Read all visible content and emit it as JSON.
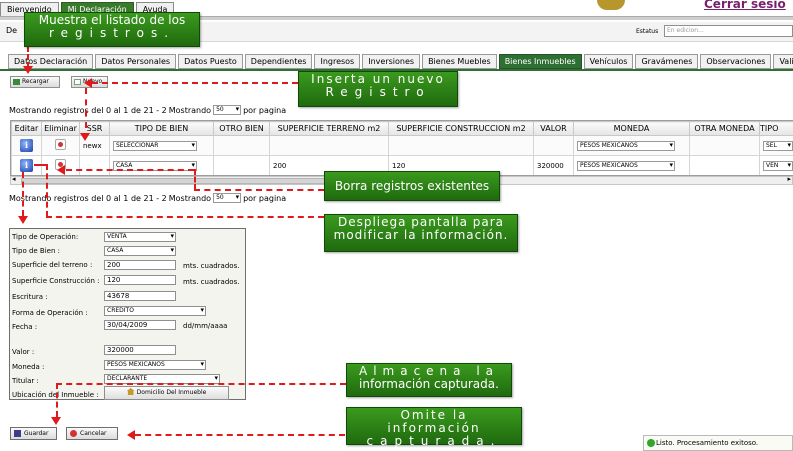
{
  "header": {
    "tabs": [
      {
        "label": "Bienvenido",
        "active": false
      },
      {
        "label": "Mi Declaración",
        "active": true
      },
      {
        "label": "Ayuda",
        "active": false
      }
    ],
    "logout_link": "Cerrar sesio"
  },
  "status_bar": {
    "prefix_label": "De",
    "estatus_label": "Estatus",
    "estatus_value": "En edicion..."
  },
  "section_tabs": [
    {
      "label": "Datos Declaración",
      "active": false
    },
    {
      "label": "Datos Personales",
      "active": false
    },
    {
      "label": "Datos Puesto",
      "active": false
    },
    {
      "label": "Dependientes",
      "active": false
    },
    {
      "label": "Ingresos",
      "active": false
    },
    {
      "label": "Inversiones",
      "active": false
    },
    {
      "label": "Bienes Muebles",
      "active": false
    },
    {
      "label": "Bienes Inmuebles",
      "active": true
    },
    {
      "label": "Vehículos",
      "active": false
    },
    {
      "label": "Gravámenes",
      "active": false
    },
    {
      "label": "Observaciones",
      "active": false
    },
    {
      "label": "Validación",
      "active": false
    }
  ],
  "toolbar": {
    "reload_label": "Recargar",
    "new_label": "Nuevo"
  },
  "grid": {
    "paging_text_top": "Mostrando registros del 0 al 1 de 21 - 2",
    "paging_text_bottom": "Mostrando registros del 0 al 1 de 21 - 2",
    "per_page_prefix": "Mostrando",
    "per_page_value": "50",
    "per_page_suffix": "por pagina",
    "columns": [
      "Editar",
      "Eliminar",
      "SSR",
      "TIPO DE BIEN",
      "OTRO BIEN",
      "SUPERFICIE TERRENO m2",
      "SUPERFICIE CONSTRUCCION m2",
      "VALOR",
      "MONEDA",
      "OTRA MONEDA",
      "TIPO"
    ],
    "rows": [
      {
        "ssr": "newx",
        "tipo_bien": "SELECCIONAR",
        "otro_bien": "",
        "sup_terreno": "",
        "sup_construccion": "",
        "valor": "",
        "moneda": "PESOS MEXICANOS",
        "otra_moneda": "",
        "tipo": "SEL"
      },
      {
        "ssr": "",
        "tipo_bien": "CASA",
        "otro_bien": "",
        "sup_terreno": "200",
        "sup_construccion": "120",
        "valor": "320000",
        "moneda": "PESOS MEXICANOS",
        "otra_moneda": "",
        "tipo": "VEN"
      }
    ]
  },
  "form": {
    "tipo_operacion": {
      "label": "Tipo de Operación:",
      "value": "VENTA"
    },
    "tipo_bien": {
      "label": "Tipo de Bien :",
      "value": "CASA"
    },
    "superficie_terreno": {
      "label": "Superficie del terreno :",
      "value": "200",
      "unit": "mts. cuadrados."
    },
    "superficie_construccion": {
      "label": "Superficie Construcción :",
      "value": "120",
      "unit": "mts. cuadrados."
    },
    "escritura": {
      "label": "Escritura :",
      "value": "43678"
    },
    "forma_operacion": {
      "label": "Forma de Operación :",
      "value": "CREDITO"
    },
    "fecha": {
      "label": "Fecha :",
      "value": "30/04/2009",
      "format": "dd/mm/aaaa"
    },
    "valor": {
      "label": "Valor :",
      "value": "320000"
    },
    "moneda": {
      "label": "Moneda :",
      "value": "PESOS MEXICANOS"
    },
    "titular": {
      "label": "Titular :",
      "value": "DECLARANTE"
    },
    "ubicacion": {
      "label": "Ubicación del Inmueble :",
      "button": "Domicilio Del Inmueble"
    },
    "save_label": "Guardar",
    "cancel_label": "Cancelar"
  },
  "callouts": {
    "listado": {
      "line1": "Muestra el listado de los",
      "line2": "registros."
    },
    "nuevo": {
      "line1": "Inserta un nuevo",
      "line2": "Registro"
    },
    "borra": {
      "line1": "Borra registros existentes"
    },
    "despliega": {
      "line1": "Despliega pantalla para",
      "line2": "modificar la información."
    },
    "almacena": {
      "line1": "Almacena la",
      "line2": "información capturada."
    },
    "omite": {
      "line1": "Omite la información",
      "line2": "capturada."
    }
  },
  "status_message": "Listo. Procesamiento exitoso.",
  "colors": {
    "accent_green": "#2f6f33",
    "callout_green": "#3b9a1e",
    "arrow_red": "#e01a1a",
    "logout_purple": "#7a1f6e"
  }
}
